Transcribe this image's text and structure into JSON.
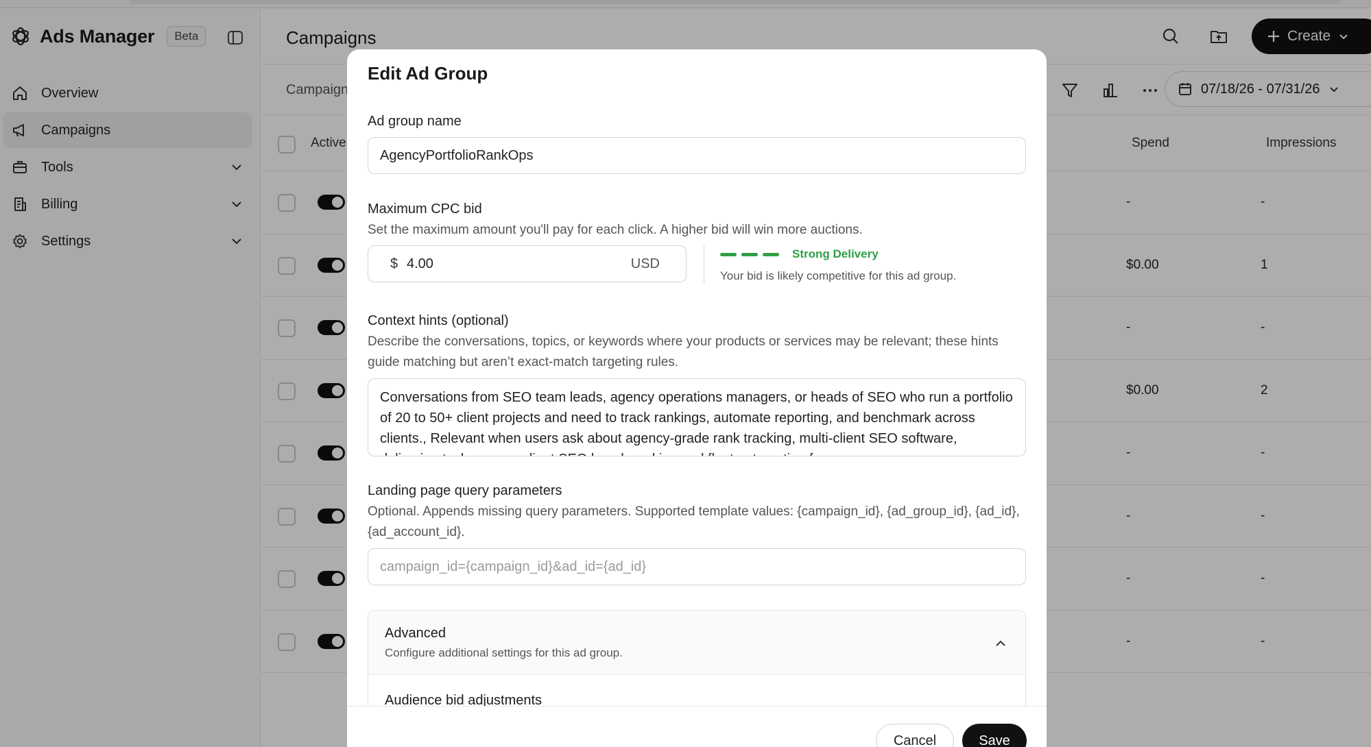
{
  "app": {
    "name": "Ads Manager",
    "badge": "Beta"
  },
  "sidebar": {
    "items": [
      {
        "label": "Overview",
        "icon": "home-icon",
        "active": false,
        "expandable": false
      },
      {
        "label": "Campaigns",
        "icon": "megaphone-icon",
        "active": true,
        "expandable": false
      },
      {
        "label": "Tools",
        "icon": "briefcase-icon",
        "active": false,
        "expandable": true
      },
      {
        "label": "Billing",
        "icon": "receipt-icon",
        "active": false,
        "expandable": true
      },
      {
        "label": "Settings",
        "icon": "gear-icon",
        "active": false,
        "expandable": true
      }
    ]
  },
  "header": {
    "title": "Campaigns",
    "create_label": "Create"
  },
  "toolbar": {
    "tab_label": "Campaign",
    "date_range": "07/18/26 - 07/31/26"
  },
  "table": {
    "columns": {
      "active": "Active",
      "spend": "Spend",
      "impressions": "Impressions"
    },
    "rows": [
      {
        "spend": "-",
        "impressions": "-"
      },
      {
        "spend": "$0.00",
        "impressions": "1"
      },
      {
        "spend": "-",
        "impressions": "-"
      },
      {
        "spend": "$0.00",
        "impressions": "2"
      },
      {
        "spend": "-",
        "impressions": "-"
      },
      {
        "spend": "-",
        "impressions": "-"
      },
      {
        "spend": "-",
        "impressions": "-"
      },
      {
        "spend": "-",
        "impressions": "-"
      }
    ]
  },
  "modal": {
    "title": "Edit Ad Group",
    "name_label": "Ad group name",
    "name_value": "AgencyPortfolioRankOps",
    "bid_label": "Maximum CPC bid",
    "bid_help": "Set the maximum amount you'll pay for each click. A higher bid will win more auctions.",
    "bid_currency_symbol": "$",
    "bid_value": "4.00",
    "bid_unit": "USD",
    "strength_label": "Strong Delivery",
    "strength_desc": "Your bid is likely competitive for this ad group.",
    "strength_color": "#2f9e44",
    "context_label": "Context hints (optional)",
    "context_help": "Describe the conversations, topics, or keywords where your products or services may be relevant; these hints guide matching but aren’t exact-match targeting rules.",
    "context_value": "Conversations from SEO team leads, agency operations managers, or heads of SEO who run a portfolio of 20 to 50+ client projects and need to track rankings, automate reporting, and benchmark across clients., Relevant when users ask about agency-grade rank tracking, multi-client SEO software, delivering tasks across client SEO benchmarking and fleet automation for",
    "lp_label": "Landing page query parameters",
    "lp_help": "Optional. Appends missing query parameters. Supported template values: {campaign_id}, {ad_group_id}, {ad_id}, {ad_account_id}.",
    "lp_placeholder": "campaign_id={campaign_id}&ad_id={ad_id}",
    "advanced_title": "Advanced",
    "advanced_desc": "Configure additional settings for this ad group.",
    "advanced_sub": "Audience bid adjustments",
    "cancel_label": "Cancel",
    "save_label": "Save"
  }
}
